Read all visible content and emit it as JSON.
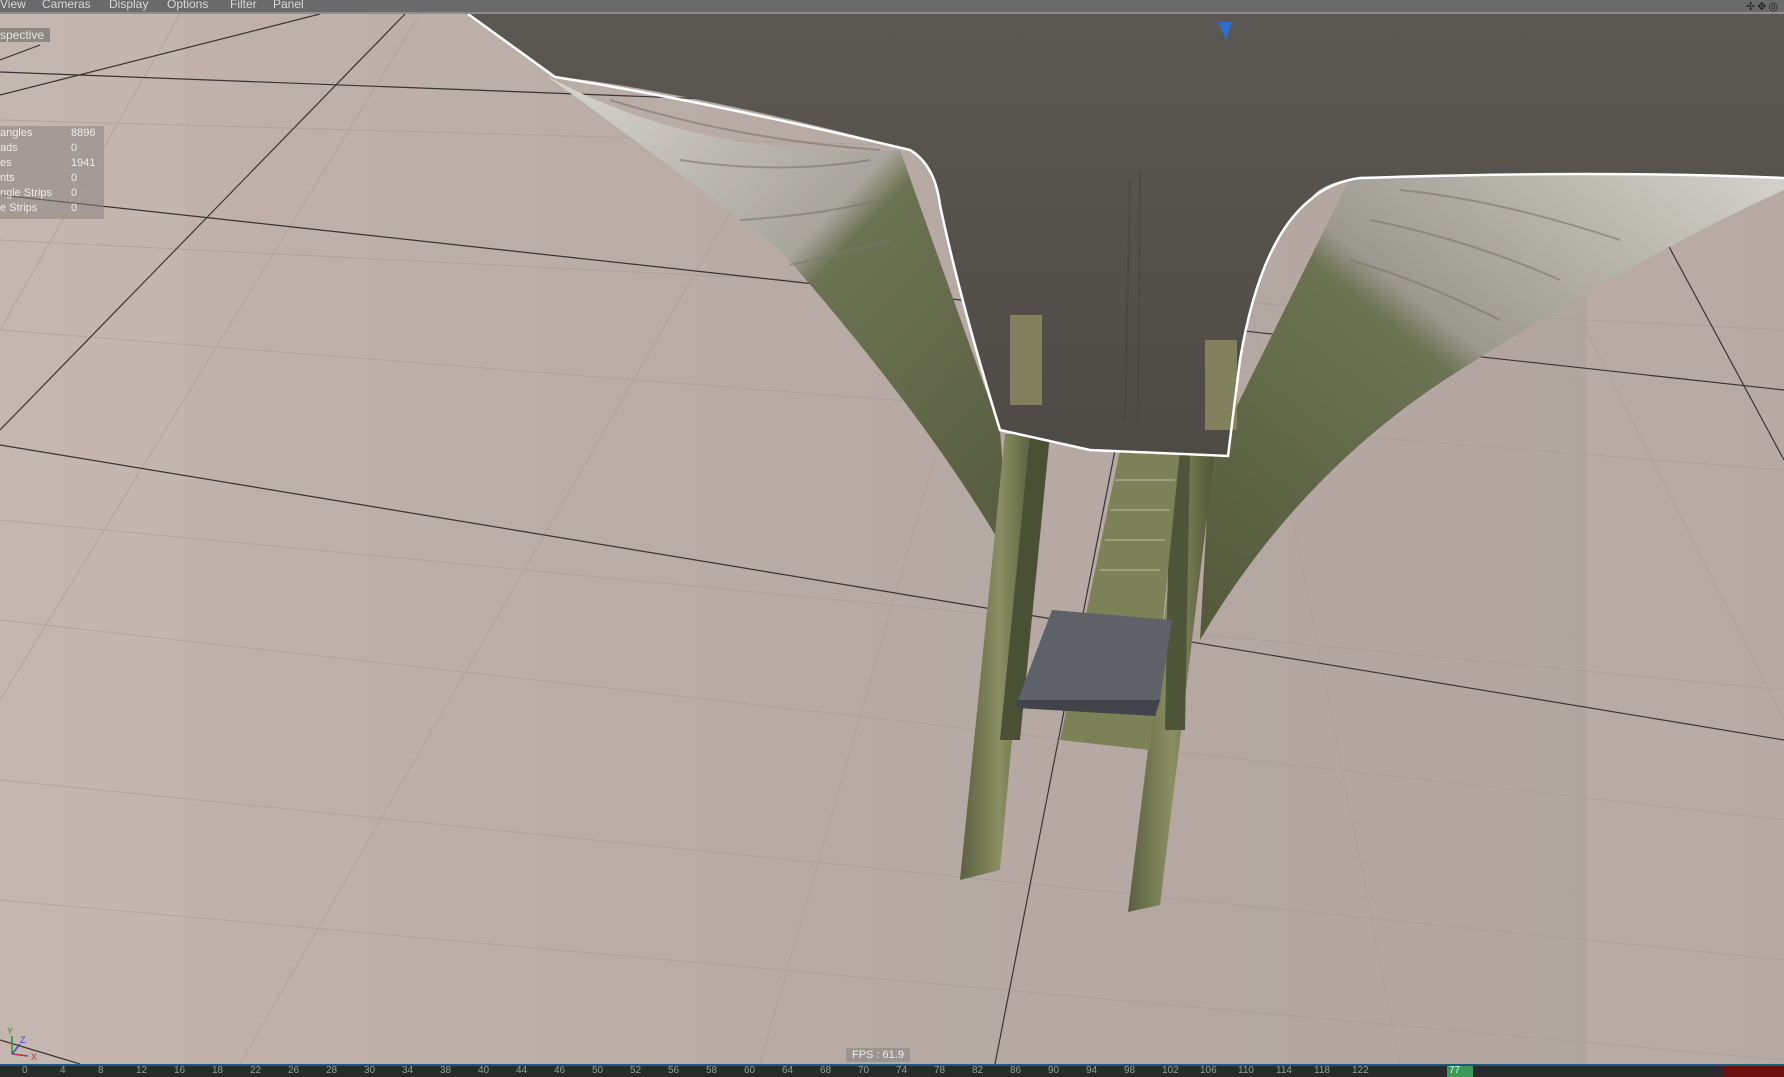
{
  "menu": {
    "items": [
      {
        "label": "View"
      },
      {
        "label": "Cameras"
      },
      {
        "label": "Display"
      },
      {
        "label": "Options"
      },
      {
        "label": "Filter"
      },
      {
        "label": "Panel"
      }
    ],
    "corner_tools": "✢✥◎"
  },
  "viewport": {
    "label": "spective",
    "stats": [
      {
        "name": "angles",
        "value": "8896"
      },
      {
        "name": "ads",
        "value": "0"
      },
      {
        "name": "es",
        "value": "1941"
      },
      {
        "name": "nts",
        "value": "0"
      },
      {
        "name": "ngle Strips",
        "value": "0"
      },
      {
        "name": "e Strips",
        "value": "0"
      }
    ],
    "fps": "FPS : 61.9",
    "axis": {
      "y": "Y",
      "z": "Z",
      "x": "X"
    },
    "colors": {
      "floor": "#b9aca6",
      "grid_major": "#3a3432",
      "selection": "#ffffff",
      "texture_dark": "#5a5650",
      "texture_green": "#6b7152"
    }
  },
  "timeline": {
    "ticks": [
      "0",
      "4",
      "8",
      "12",
      "16",
      "18",
      "22",
      "26",
      "28",
      "30",
      "34",
      "38",
      "40",
      "44",
      "46",
      "50",
      "52",
      "56",
      "58",
      "60",
      "64",
      "68",
      "70",
      "74",
      "78",
      "82",
      "86",
      "90",
      "94",
      "98",
      "102",
      "106",
      "110",
      "114",
      "118",
      "122"
    ],
    "current_frame": "77"
  }
}
